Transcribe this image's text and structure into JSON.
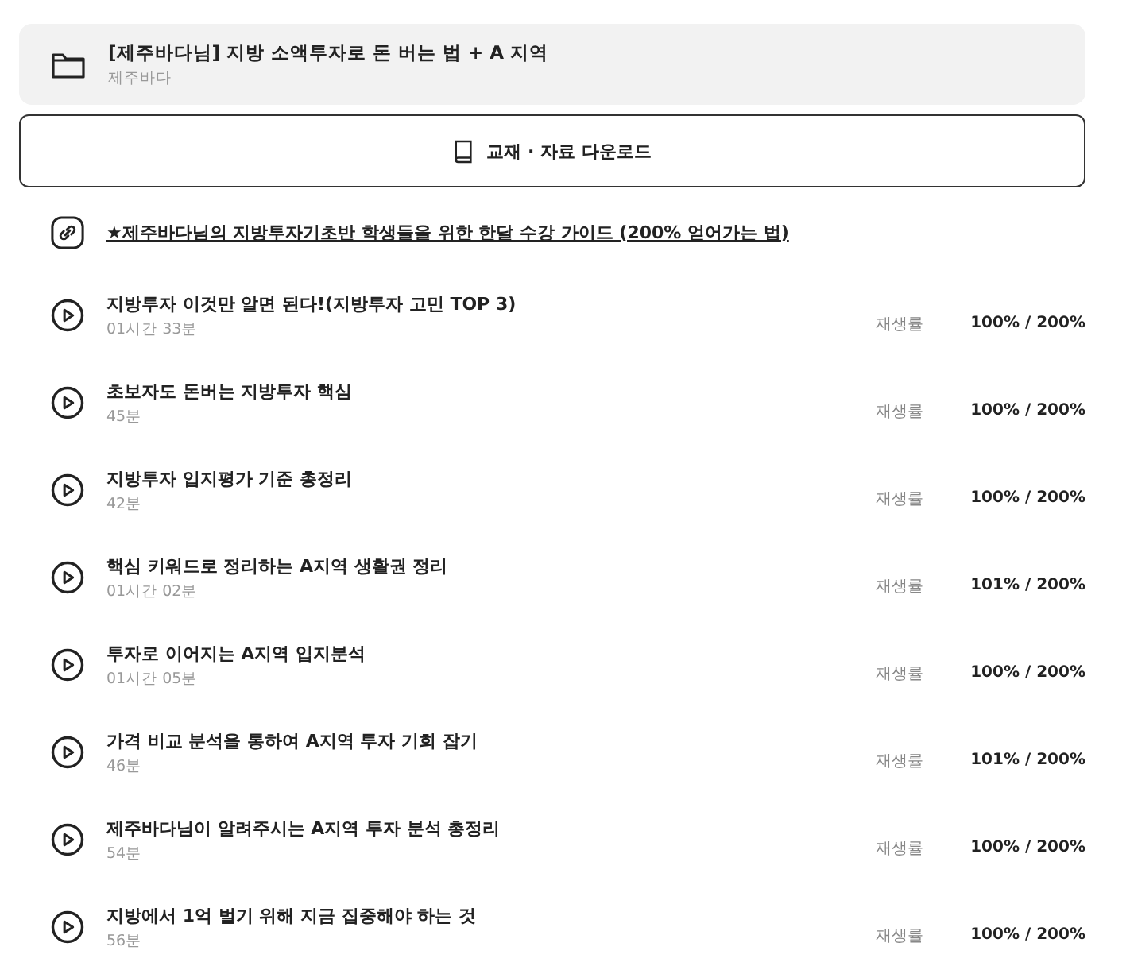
{
  "course": {
    "title": "[제주바다님] 지방 소액투자로 돈 버는 법 + A 지역",
    "author": "제주바다"
  },
  "download_button": {
    "label": "교재 · 자료 다운로드"
  },
  "guide_link": {
    "label": "★제주바다님의 지방투자기초반 학생들을 위한 한달 수강 가이드 (200% 얻어가는 법)"
  },
  "lectures": [
    {
      "title": "지방투자 이것만 알면 된다!(지방투자 고민 TOP 3)",
      "duration": "01시간 33분",
      "progress_label": "재생률",
      "progress": "100% / 200%"
    },
    {
      "title": "초보자도 돈버는 지방투자 핵심",
      "duration": "45분",
      "progress_label": "재생률",
      "progress": "100% / 200%"
    },
    {
      "title": "지방투자 입지평가 기준 총정리",
      "duration": "42분",
      "progress_label": "재생률",
      "progress": "100% / 200%"
    },
    {
      "title": "핵심 키워드로 정리하는 A지역 생활권 정리",
      "duration": "01시간 02분",
      "progress_label": "재생률",
      "progress": "101% / 200%"
    },
    {
      "title": "투자로 이어지는 A지역 입지분석",
      "duration": "01시간 05분",
      "progress_label": "재생률",
      "progress": "100% / 200%"
    },
    {
      "title": "가격 비교 분석을 통하여 A지역 투자 기회 잡기",
      "duration": "46분",
      "progress_label": "재생률",
      "progress": "101% / 200%"
    },
    {
      "title": "제주바다님이 알려주시는 A지역 투자 분석 총정리",
      "duration": "54분",
      "progress_label": "재생률",
      "progress": "100% / 200%"
    },
    {
      "title": "지방에서 1억 벌기 위해 지금 집중해야 하는 것",
      "duration": "56분",
      "progress_label": "재생률",
      "progress": "100% / 200%"
    }
  ]
}
